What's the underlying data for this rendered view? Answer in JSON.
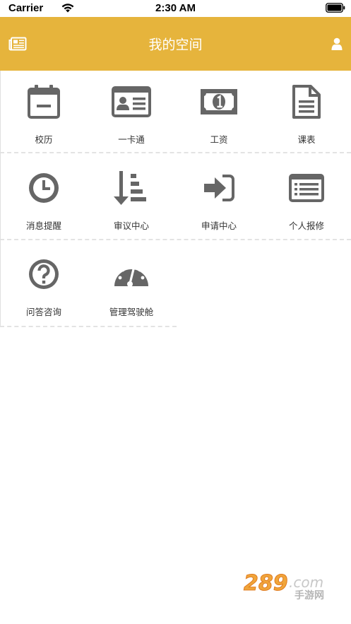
{
  "status_bar": {
    "carrier": "Carrier",
    "time": "2:30 AM"
  },
  "header": {
    "title": "我的空间",
    "left_icon": "newspaper-icon",
    "right_icon": "user-icon"
  },
  "colors": {
    "header_bg": "#e6b43c",
    "icon_gray": "#666666",
    "label_text": "#333333"
  },
  "grid": {
    "items": [
      {
        "label": "校历",
        "icon": "calendar-icon"
      },
      {
        "label": "一卡通",
        "icon": "id-card-icon"
      },
      {
        "label": "工资",
        "icon": "money-icon"
      },
      {
        "label": "课表",
        "icon": "document-icon"
      },
      {
        "label": "消息提醒",
        "icon": "clock-icon"
      },
      {
        "label": "审议中心",
        "icon": "sort-amount-icon"
      },
      {
        "label": "申请中心",
        "icon": "sign-in-icon"
      },
      {
        "label": "个人报修",
        "icon": "list-panel-icon"
      },
      {
        "label": "问答咨询",
        "icon": "question-icon"
      },
      {
        "label": "管理驾驶舱",
        "icon": "dashboard-icon"
      }
    ]
  },
  "watermark": {
    "text_num": "289",
    "text_com": ".com",
    "text_cn": "手游网"
  }
}
